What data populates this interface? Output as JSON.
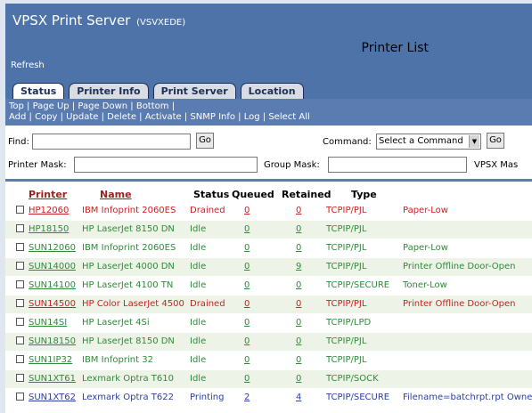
{
  "header": {
    "app_title": "VPSX Print Server",
    "server": "(VSVXEDE)",
    "page_title": "Printer List",
    "refresh": "Refresh"
  },
  "tabs": [
    {
      "label": "Status",
      "active": true
    },
    {
      "label": "Printer Info",
      "active": false
    },
    {
      "label": "Print Server",
      "active": false
    },
    {
      "label": "Location",
      "active": false
    }
  ],
  "nav": {
    "line1": "Top | Page Up | Page Down | Bottom |",
    "line2": "Add | Copy | Update | Delete | Activate | SNMP Info | Log | Select All"
  },
  "controls": {
    "find_label": "Find:",
    "go_label": "Go",
    "command_label": "Command:",
    "command_value": "Select a Command",
    "printer_mask_label": "Printer Mask:",
    "group_mask_label": "Group Mask:",
    "vpsx_mask_label": "VPSX Mas"
  },
  "table": {
    "headers": {
      "printer": "Printer",
      "name": "Name",
      "status": "Status",
      "queued": "Queued",
      "retained": "Retained",
      "type": "Type"
    },
    "rows": [
      {
        "printer": "HP12060",
        "name": "IBM Infoprint 2060ES",
        "status": "Drained",
        "queued": "0",
        "retained": "0",
        "type": "TCPIP/PJL",
        "message": "Paper-Low",
        "color": "#cc1f1f"
      },
      {
        "printer": "HP18150",
        "name": "HP LaserJet 8150 DN",
        "status": "Idle",
        "queued": "0",
        "retained": "0",
        "type": "TCPIP/PJL",
        "message": "",
        "color": "#2f8a3a"
      },
      {
        "printer": "SUN12060",
        "name": "IBM Infoprint 2060ES",
        "status": "Idle",
        "queued": "0",
        "retained": "0",
        "type": "TCPIP/PJL",
        "message": "Paper-Low",
        "color": "#2f8a3a"
      },
      {
        "printer": "SUN14000",
        "name": "HP LaserJet 4000 DN",
        "status": "Idle",
        "queued": "0",
        "retained": "9",
        "type": "TCPIP/PJL",
        "message": "Printer Offline Door-Open",
        "color": "#2f8a3a"
      },
      {
        "printer": "SUN14100",
        "name": "HP LaserJet 4100 TN",
        "status": "Idle",
        "queued": "0",
        "retained": "0",
        "type": "TCPIP/SECURE",
        "message": "Toner-Low",
        "color": "#2f8a3a"
      },
      {
        "printer": "SUN14500",
        "name": "HP Color LaserJet 4500",
        "status": "Drained",
        "queued": "0",
        "retained": "0",
        "type": "TCPIP/PJL",
        "message": "Printer Offline Door-Open",
        "color": "#cc1f1f"
      },
      {
        "printer": "SUN14SI",
        "name": "HP LaserJet 4Si",
        "status": "Idle",
        "queued": "0",
        "retained": "0",
        "type": "TCPIP/LPD",
        "message": "",
        "color": "#2f8a3a"
      },
      {
        "printer": "SUN18150",
        "name": "HP LaserJet 8150 DN",
        "status": "Idle",
        "queued": "0",
        "retained": "0",
        "type": "TCPIP/PJL",
        "message": "",
        "color": "#2f8a3a"
      },
      {
        "printer": "SUN1IP32",
        "name": "IBM Infoprint 32",
        "status": "Idle",
        "queued": "0",
        "retained": "0",
        "type": "TCPIP/PJL",
        "message": "",
        "color": "#2f8a3a"
      },
      {
        "printer": "SUN1XT61",
        "name": "Lexmark Optra T610",
        "status": "Idle",
        "queued": "0",
        "retained": "0",
        "type": "TCPIP/SOCK",
        "message": "",
        "color": "#2f8a3a"
      },
      {
        "printer": "SUN1XT62",
        "name": "Lexmark Optra T622",
        "status": "Printing",
        "queued": "2",
        "retained": "4",
        "type": "TCPIP/SECURE",
        "message": "Filename=batchrpt.rpt Owner",
        "color": "#2a3fa0"
      }
    ]
  }
}
